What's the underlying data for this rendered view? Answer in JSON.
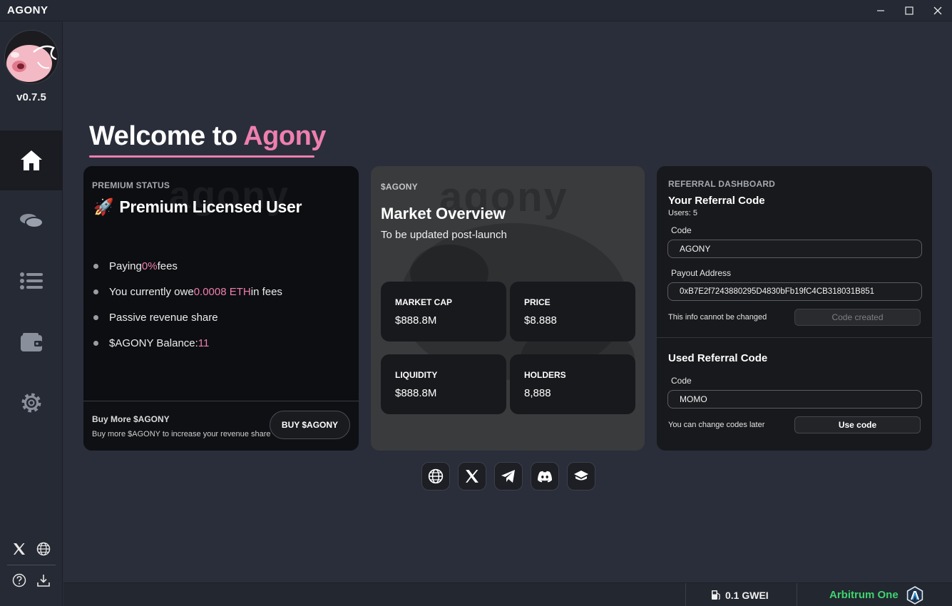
{
  "app": {
    "title": "AGONY",
    "version": "v0.7.5"
  },
  "window_controls": [
    "minimize",
    "maximize",
    "close"
  ],
  "sidebar": {
    "items": [
      {
        "name": "home",
        "icon": "home-icon",
        "active": true
      },
      {
        "name": "coins",
        "icon": "coins-icon",
        "active": false
      },
      {
        "name": "list",
        "icon": "list-icon",
        "active": false
      },
      {
        "name": "wallet",
        "icon": "wallet-icon",
        "active": false
      },
      {
        "name": "settings",
        "icon": "gear-icon",
        "active": false
      }
    ],
    "bottom_icons": [
      "x-icon",
      "globe-icon",
      "help-icon",
      "download-icon"
    ]
  },
  "welcome": {
    "prefix": "Welcome to ",
    "brand": "Agony"
  },
  "premium": {
    "label": "PREMIUM STATUS",
    "emoji": "🚀",
    "title": "Premium Licensed User",
    "bullets": [
      {
        "pre": "Paying ",
        "hl": "0%",
        "post": " fees"
      },
      {
        "pre": "You currently owe ",
        "hl": "0.0008 ETH",
        "post": " in fees"
      },
      {
        "pre": "Passive revenue share",
        "hl": "",
        "post": ""
      },
      {
        "pre": "$AGONY Balance: ",
        "hl": "11",
        "post": ""
      }
    ],
    "footer": {
      "title": "Buy More $AGONY",
      "subtitle": "Buy more $AGONY to increase your revenue share",
      "button": "BUY $AGONY"
    }
  },
  "market": {
    "label": "$AGONY",
    "title": "Market Overview",
    "subtitle": "To be updated post-launch",
    "stats": [
      {
        "label": "MARKET CAP",
        "value": "$888.8M"
      },
      {
        "label": "PRICE",
        "value": "$8.888"
      },
      {
        "label": "LIQUIDITY",
        "value": "$888.8M"
      },
      {
        "label": "HOLDERS",
        "value": "8,888"
      }
    ]
  },
  "referral": {
    "label": "REFERRAL DASHBOARD",
    "your_title": "Your Referral Code",
    "users": "Users: 5",
    "code_label": "Code",
    "code_value": "AGONY",
    "payout_label": "Payout Address",
    "payout_value": "0xB7E2f7243880295D4830bFb19fC4CB318031B851",
    "note_locked": "This info cannot be changed",
    "created_button": "Code created",
    "used_title": "Used Referral Code",
    "used_code_label": "Code",
    "used_code_value": "MOMO",
    "note_change": "You can change codes later",
    "use_button": "Use code"
  },
  "socials": [
    "globe-icon",
    "x-icon",
    "telegram-icon",
    "discord-icon",
    "docs-icon"
  ],
  "status": {
    "gas": "0.1 GWEI",
    "network": "Arbitrum One"
  },
  "colors": {
    "accent": "#ee7fae",
    "network": "#3ed46e",
    "background": "#2a2e3a"
  }
}
